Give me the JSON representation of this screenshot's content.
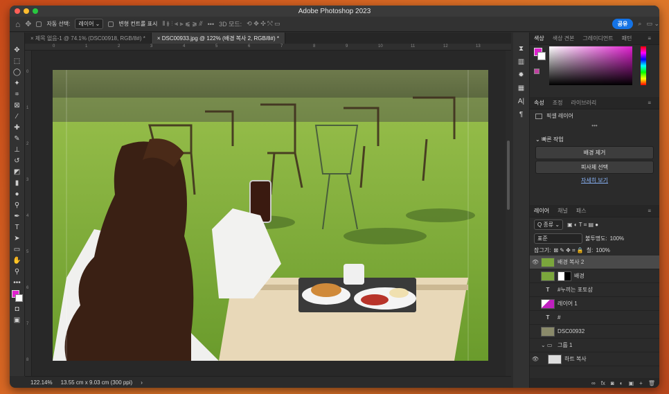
{
  "window": {
    "title": "Adobe Photoshop 2023"
  },
  "options_bar": {
    "auto_select_label": "자동 선택:",
    "auto_select_value": "레이어",
    "transform_controls_label": "변형 컨트롤 표시",
    "mode_3d_label": "3D 모드:",
    "share_label": "공유"
  },
  "tabs": [
    {
      "label": "제목 없음-1 @ 74.1% (DSC00918, RGB/8#) *",
      "close": "×"
    },
    {
      "label": "DSC00933.jpg @ 122% (배경 복사 2, RGB/8#) *",
      "close": "×"
    }
  ],
  "status": {
    "zoom": "122.14%",
    "doc_size": "13.55 cm x 9.03 cm (300 ppi)",
    "arrow": "›"
  },
  "rulers": {
    "top": [
      "0",
      "1",
      "2",
      "3",
      "4",
      "5",
      "6",
      "7",
      "8",
      "9",
      "10",
      "11",
      "12",
      "13"
    ],
    "left": [
      "0",
      "1",
      "2",
      "3",
      "4",
      "5",
      "6",
      "7",
      "8"
    ]
  },
  "color_panel": {
    "tabs": [
      "색상",
      "색상 견본",
      "그레이디언트",
      "패턴"
    ],
    "fg_color": "#e020d0"
  },
  "properties_panel": {
    "tabs": [
      "속성",
      "조정",
      "라이브러리"
    ],
    "layer_type": "픽셀 레이어",
    "quick_actions_title": "빠른 작업",
    "remove_bg_label": "배경 제거",
    "select_subject_label": "피사체 선택",
    "more_link": "자세히 보기"
  },
  "layers_panel": {
    "tabs": [
      "레이어",
      "채널",
      "패스"
    ],
    "filter_label": "Q 종류",
    "blend_mode": "표준",
    "opacity_label": "불투명도:",
    "opacity_value": "100%",
    "lock_label": "잠그기:",
    "fill_label": "칠:",
    "fill_value": "100%",
    "layers": [
      {
        "name": "배경 복사 2",
        "type": "image",
        "visible": true,
        "selected": true
      },
      {
        "name": "배경",
        "type": "masked",
        "visible": false,
        "selected": false
      },
      {
        "name": "#누끼는 포토샵",
        "type": "text",
        "visible": false,
        "selected": false
      },
      {
        "name": "레이어 1",
        "type": "shape",
        "visible": false,
        "selected": false
      },
      {
        "name": "#",
        "type": "text",
        "visible": false,
        "selected": false
      },
      {
        "name": "DSC00932",
        "type": "image",
        "visible": false,
        "selected": false
      },
      {
        "name": "그룹 1",
        "type": "group",
        "visible": false,
        "selected": false
      },
      {
        "name": "하트 복사",
        "type": "shape",
        "visible": true,
        "selected": false
      }
    ]
  },
  "icons": {
    "eye": "👁",
    "text_glyph": "T",
    "folder": "📁",
    "menu": "≡",
    "dots": "•••",
    "search": "⌕",
    "home": "⌂",
    "layer_footer": [
      "∞",
      "fx",
      "◙",
      "◐",
      "▣",
      "+",
      "🗑"
    ]
  }
}
